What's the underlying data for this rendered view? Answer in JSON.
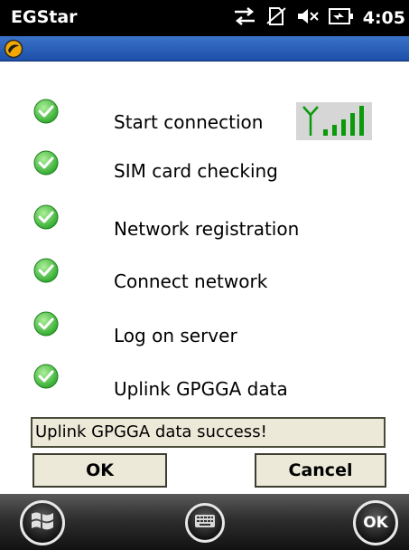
{
  "app": {
    "title": "EGStar"
  },
  "status_bar": {
    "time": "4:05",
    "icons": [
      "data-transfer-icon",
      "no-sim-icon",
      "speaker-muted-icon",
      "battery-charging-icon"
    ]
  },
  "title_bar": {
    "logo": "app-logo-icon"
  },
  "steps": [
    {
      "label": "Start connection",
      "status": "success"
    },
    {
      "label": "SIM card checking",
      "status": "success"
    },
    {
      "label": "Network registration",
      "status": "success"
    },
    {
      "label": "Connect network",
      "status": "success"
    },
    {
      "label": "Log on server",
      "status": "success"
    },
    {
      "label": "Uplink GPGGA data",
      "status": "success"
    }
  ],
  "signal": {
    "icon": "signal-strength-icon",
    "level": 5,
    "max": 5
  },
  "status_message": "Uplink GPGGA data success!",
  "buttons": {
    "ok": "OK",
    "cancel": "Cancel"
  },
  "taskbar": {
    "ok_label": "OK"
  },
  "colors": {
    "check": "#2fb52f",
    "signal": "#0a9a0a",
    "titlebar": "#2a5fba"
  }
}
